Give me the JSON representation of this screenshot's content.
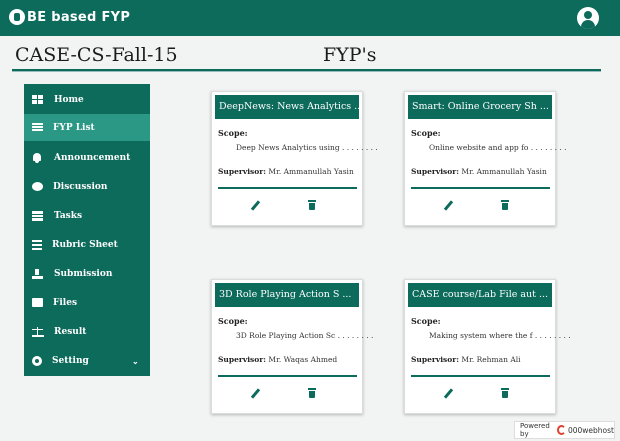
{
  "brand": {
    "name": "BE based FYP"
  },
  "header": {
    "course": "CASE-CS-Fall-15",
    "title": "FYP's"
  },
  "sidebar": {
    "items": [
      {
        "label": "Home",
        "icon": "grid-icon"
      },
      {
        "label": "FYP List",
        "icon": "list-icon",
        "active": true
      },
      {
        "label": "Announcement",
        "icon": "bell-icon"
      },
      {
        "label": "Discussion",
        "icon": "chat-icon"
      },
      {
        "label": "Tasks",
        "icon": "tasks-icon"
      },
      {
        "label": "Rubric Sheet",
        "icon": "rubric-icon"
      },
      {
        "label": "Submission",
        "icon": "upload-icon"
      },
      {
        "label": "Files",
        "icon": "folder-icon"
      },
      {
        "label": "Result",
        "icon": "scale-icon"
      },
      {
        "label": "Setting",
        "icon": "gear-icon",
        "chevron": "chevron-down-icon"
      }
    ]
  },
  "scope_label": "Scope:",
  "supervisor_label": "Supervisor:",
  "cards": [
    {
      "title": "DeepNews: News Analytics ...",
      "scope": "Deep News Analytics using . . . . . . . .",
      "supervisor": "Mr. Ammanullah Yasin"
    },
    {
      "title": "Smart: Online Grocery Sh ...",
      "scope": "Online website and app fo . . . . . . . .",
      "supervisor": "Mr. Ammanullah Yasin"
    },
    {
      "title": "3D Role Playing Action S ...",
      "scope": "3D Role Playing Action Sc . . . . . . . .",
      "supervisor": "Mr. Waqas Ahmed"
    },
    {
      "title": "CASE course/Lab File aut ...",
      "scope": "Making system where the f . . . . . . . .",
      "supervisor": "Mr. Rehman Ali"
    }
  ],
  "footer": {
    "powered_by": "Powered by",
    "host": "000webhost"
  },
  "colors": {
    "primary": "#0d6b5c",
    "active": "#2a9885",
    "background": "#f2f4f4",
    "host_accent": "#e0402f"
  }
}
